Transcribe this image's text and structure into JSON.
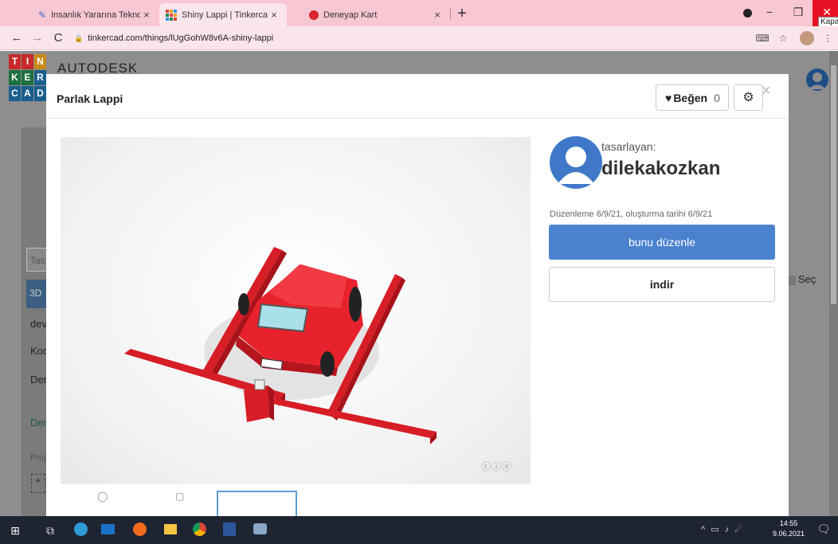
{
  "browser": {
    "tabs": [
      {
        "title": "İnsanlık Yararına Teknoloji Yarışm",
        "icon": "pencil-icon",
        "close": "×",
        "active": false
      },
      {
        "title": "Shiny Lappi | Tinkercad",
        "icon": "tinkercad-icon",
        "close": "×",
        "active": true
      },
      {
        "title": "Deneyap Kart",
        "icon": "deneyap-icon",
        "close": "×",
        "active": false
      }
    ],
    "new_tab": "+",
    "window": {
      "minimize": "−",
      "restore": "❐",
      "close": "✕",
      "close_tooltip": "Kapat"
    },
    "address": "tinkercad.com/things/lUgGohW8v6A-shiny-lappi",
    "colors": {
      "tabbar": "#f7c7d3",
      "toolbar": "#fbe5ec"
    }
  },
  "background_page": {
    "logo_letters": [
      "T",
      "I",
      "N",
      "K",
      "E",
      "R",
      "C",
      "A",
      "D"
    ],
    "brand": "AUTODESK",
    "sidebar_items": [
      "Tas",
      "3D",
      "dev",
      "Koc",
      "Den",
      "Den",
      "Proj",
      "+"
    ],
    "select_label": "Seç"
  },
  "modal": {
    "title": "Parlak Lappi",
    "like_label": "Beğen",
    "like_count": "0",
    "designer_label": "tasarlayan:",
    "designer_name": "dilekakozkan",
    "dates": "Düzenleme 6/9/21, oluşturma tarihi 6/9/21",
    "edit_button": "bunu düzenle",
    "download_button": "indir",
    "license_badge": "ⓒⓘⓞ",
    "primary_color": "#4a82cf",
    "model_color": "#e8222c"
  },
  "taskbar": {
    "time": "14:55",
    "date": "9.06.2021",
    "icons": [
      "windows-start-icon",
      "task-view-icon",
      "edge-icon",
      "mail-icon",
      "firefox-icon",
      "file-explorer-icon",
      "chrome-icon",
      "word-icon",
      "paint-icon"
    ]
  }
}
